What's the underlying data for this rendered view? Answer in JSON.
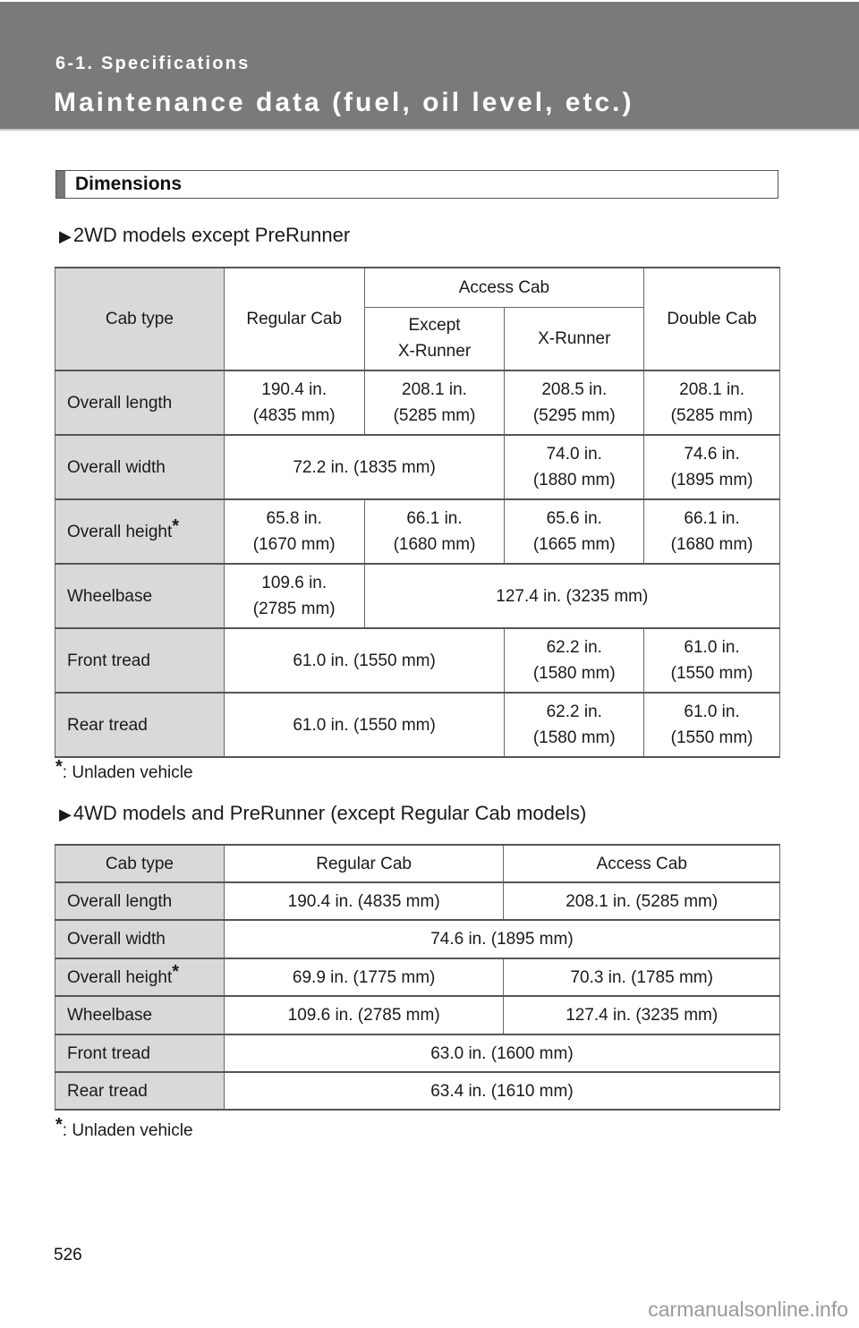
{
  "header": {
    "section": "6-1. Specifications",
    "title": "Maintenance data (fuel, oil level, etc.)"
  },
  "subsection": {
    "label": "Dimensions"
  },
  "table_2wd": {
    "heading": "2WD models except PreRunner",
    "headers": {
      "cab_type": "Cab type",
      "regular_cab": "Regular Cab",
      "access_cab": "Access Cab",
      "except_xrunner_line1": "Except",
      "except_xrunner_line2": "X-Runner",
      "xrunner": "X-Runner",
      "double_cab": "Double Cab"
    },
    "rows": {
      "overall_length": {
        "label": "Overall length",
        "regular": [
          "190.4 in.",
          "(4835 mm)"
        ],
        "access_except": [
          "208.1 in.",
          "(5285 mm)"
        ],
        "xrunner": [
          "208.5 in.",
          "(5295 mm)"
        ],
        "double": [
          "208.1 in.",
          "(5285 mm)"
        ]
      },
      "overall_width": {
        "label": "Overall width",
        "regular_access_except": "72.2 in. (1835 mm)",
        "xrunner": [
          "74.0 in.",
          "(1880 mm)"
        ],
        "double": [
          "74.6 in.",
          "(1895 mm)"
        ]
      },
      "overall_height": {
        "label": "Overall height",
        "marker": "*",
        "regular": [
          "65.8 in.",
          "(1670 mm)"
        ],
        "access_except": [
          "66.1 in.",
          "(1680 mm)"
        ],
        "xrunner": [
          "65.6 in.",
          "(1665 mm)"
        ],
        "double": [
          "66.1 in.",
          "(1680 mm)"
        ]
      },
      "wheelbase": {
        "label": "Wheelbase",
        "regular": [
          "109.6 in.",
          "(2785 mm)"
        ],
        "others": "127.4 in. (3235 mm)"
      },
      "front_tread": {
        "label": "Front tread",
        "regular_access_except": "61.0 in. (1550 mm)",
        "xrunner": [
          "62.2 in.",
          "(1580 mm)"
        ],
        "double": [
          "61.0 in.",
          "(1550 mm)"
        ]
      },
      "rear_tread": {
        "label": "Rear tread",
        "regular_access_except": "61.0 in. (1550 mm)",
        "xrunner": [
          "62.2 in.",
          "(1580 mm)"
        ],
        "double": [
          "61.0 in.",
          "(1550 mm)"
        ]
      }
    },
    "footnote_marker": "*",
    "footnote": ": Unladen vehicle"
  },
  "table_4wd": {
    "heading": "4WD models and PreRunner (except Regular Cab models)",
    "headers": {
      "cab_type": "Cab type",
      "regular_cab": "Regular Cab",
      "access_cab": "Access Cab"
    },
    "rows": [
      {
        "label": "Overall length",
        "marker": "",
        "regular": "190.4 in. (4835 mm)",
        "access": "208.1 in. (5285 mm)"
      },
      {
        "label": "Overall width",
        "marker": "",
        "both": "74.6 in. (1895 mm)"
      },
      {
        "label": "Overall height",
        "marker": "*",
        "regular": "69.9 in. (1775 mm)",
        "access": "70.3 in. (1785 mm)"
      },
      {
        "label": "Wheelbase",
        "marker": "",
        "regular": "109.6 in. (2785 mm)",
        "access": "127.4 in. (3235 mm)"
      },
      {
        "label": "Front tread",
        "marker": "",
        "both": "63.0 in. (1600 mm)"
      },
      {
        "label": "Rear tread",
        "marker": "",
        "both": "63.4 in. (1610 mm)"
      }
    ],
    "footnote_marker": "*",
    "footnote": ": Unladen vehicle"
  },
  "bullet_icon": "right-triangle",
  "page_number": "526",
  "watermark": "carmanualsonline.info"
}
